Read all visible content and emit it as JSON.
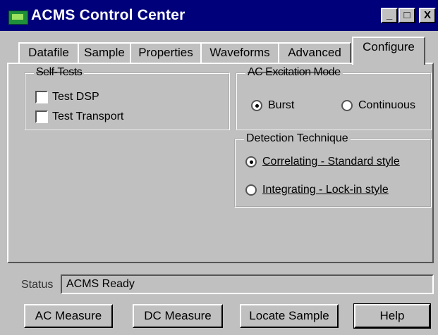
{
  "window": {
    "title": "ACMS Control Center",
    "controls": {
      "minimize": "_",
      "maximize": "□",
      "close": "X"
    }
  },
  "tabs": [
    {
      "label": "Datafile",
      "active": false
    },
    {
      "label": "Sample",
      "active": false
    },
    {
      "label": "Properties",
      "active": false
    },
    {
      "label": "Waveforms",
      "active": false
    },
    {
      "label": "Advanced",
      "active": false
    },
    {
      "label": "Configure",
      "active": true
    }
  ],
  "groups": {
    "self_tests": {
      "legend": "Self-Tests",
      "items": [
        {
          "label": "Test DSP",
          "checked": false
        },
        {
          "label": "Test Transport",
          "checked": false
        }
      ]
    },
    "excitation_mode": {
      "legend": "AC Excitation Mode",
      "options": [
        {
          "label": "Burst",
          "selected": true
        },
        {
          "label": "Continuous",
          "selected": false
        }
      ]
    },
    "detection": {
      "legend": "Detection Technique",
      "options": [
        {
          "label": "Correlating - Standard style",
          "selected": true
        },
        {
          "label": "Integrating - Lock-in style",
          "selected": false
        }
      ]
    }
  },
  "status": {
    "label": "Status",
    "value": "ACMS Ready"
  },
  "buttons": {
    "ac_measure": "AC Measure",
    "dc_measure": "DC Measure",
    "locate_sample": "Locate Sample",
    "help": "Help"
  }
}
